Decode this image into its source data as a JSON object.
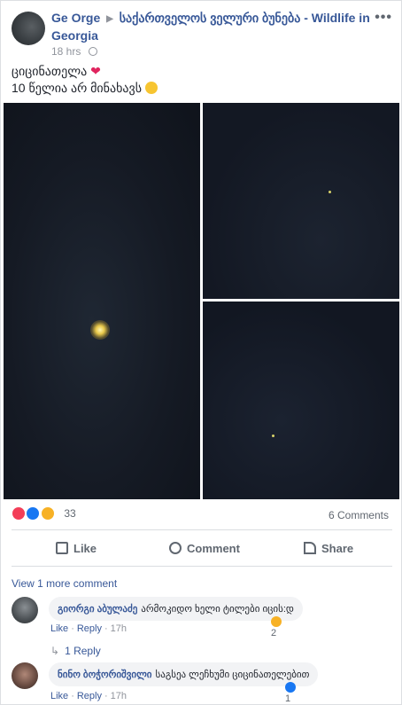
{
  "post": {
    "author": "Ge Orge",
    "group": "საქართველოს ველური ბუნება - Wildlife in Georgia",
    "time": "18 hrs",
    "line1": "ციცინათელა",
    "line2": "10 წელია არ მინახავს",
    "reaction_count": "33",
    "comments_count": "6 Comments"
  },
  "actions": {
    "like": "Like",
    "comment": "Comment",
    "share": "Share"
  },
  "comments": {
    "view_more": "View 1 more comment",
    "items": [
      {
        "author": "გიორგი აბულაძე",
        "text": "არმოკიდო ხელი ტილები იცის:დ",
        "like": "Like",
        "reply": "Reply",
        "time": "17h",
        "reactions": "2",
        "replies_link": "1 Reply"
      },
      {
        "author": "ნინო ბოჭორიშვილი",
        "text": "საგსეა ლეჩხუმი ციცინათელებით",
        "like": "Like",
        "reply": "Reply",
        "time": "17h",
        "reactions": "1"
      }
    ]
  },
  "colors": {
    "link": "#385898",
    "love": "#f33e58",
    "like": "#1877f2",
    "haha": "#f7b125"
  }
}
